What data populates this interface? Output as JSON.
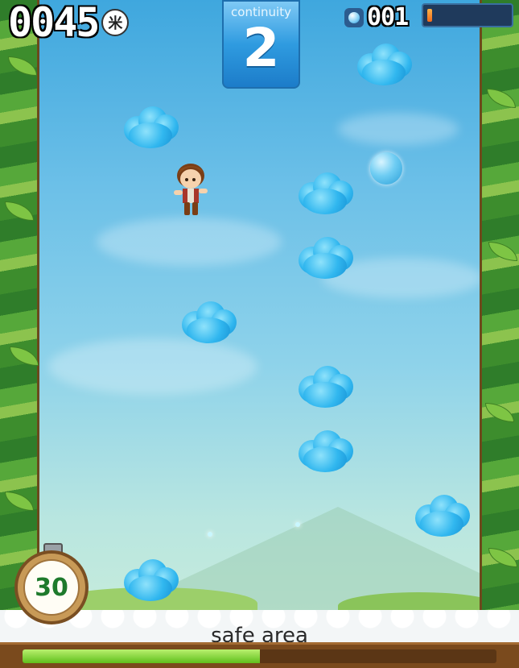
{
  "hud": {
    "distance": "0045",
    "distance_unit": "米",
    "continuity_label": "continuity",
    "continuity_value": "2",
    "coin_count": "001",
    "energy_level": 0.06
  },
  "bottom": {
    "safe_area_label": "safe area",
    "timer_value": "30",
    "progress_fraction": 0.5
  },
  "icons": {
    "coin": "bubble-coin-icon",
    "player": "player-character",
    "cloud": "cloud-platform"
  },
  "colors": {
    "sky_top": "#3fa7de",
    "cloud_blue": "#31b7ef",
    "progress_green": "#5fbf1d",
    "timer_green": "#1e7a2c"
  }
}
